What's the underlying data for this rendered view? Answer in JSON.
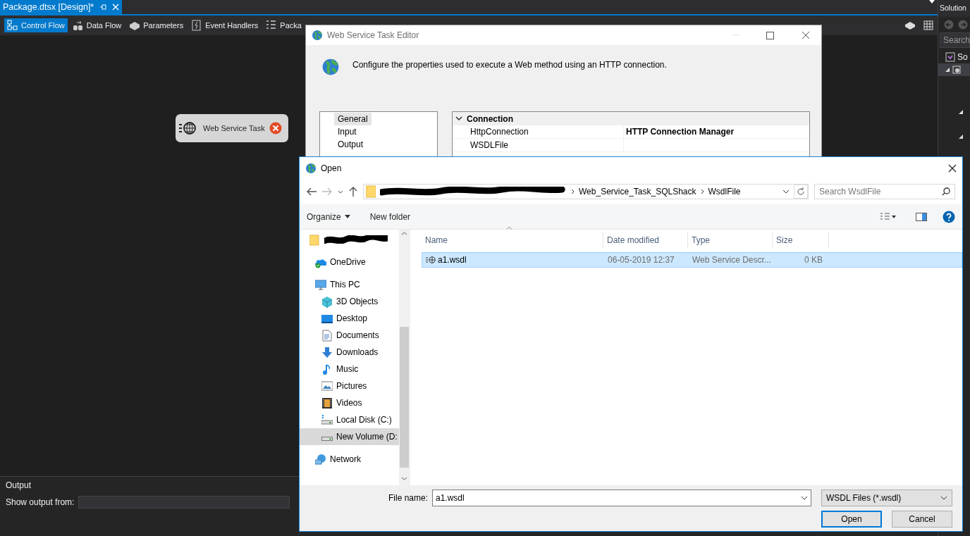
{
  "ide": {
    "document_tab": {
      "title": "Package.dtsx [Design]*"
    },
    "designer_tabs": [
      {
        "label": "Control Flow",
        "kind": "control_flow",
        "selected": true
      },
      {
        "label": "Data Flow",
        "kind": "data_flow",
        "selected": false
      },
      {
        "label": "Parameters",
        "kind": "parameters",
        "selected": false
      },
      {
        "label": "Event Handlers",
        "kind": "event_handlers",
        "selected": false
      },
      {
        "label": "Packa",
        "kind": "package_explorer",
        "selected": false
      }
    ],
    "canvas": {
      "tasks": [
        {
          "label": "Web Service Task",
          "error": true
        }
      ]
    },
    "output": {
      "title": "Output",
      "source_label": "Show output from:"
    },
    "solution_explorer": {
      "title": "Solution",
      "search_placeholder": "Search",
      "items": [
        {
          "label": "So",
          "kind": "solution",
          "selected": false
        },
        {
          "kind": "project",
          "selected": true,
          "expanded": true,
          "children": [
            {
              "expanded": true
            },
            {
              "expanded": true
            }
          ]
        }
      ]
    }
  },
  "editor": {
    "title": "Web Service Task Editor",
    "description": "Configure the properties used to execute a Web method using an HTTP connection.",
    "pages": [
      {
        "label": "General",
        "selected": true
      },
      {
        "label": "Input",
        "selected": false
      },
      {
        "label": "Output",
        "selected": false
      }
    ],
    "properties": {
      "category": "Connection",
      "expanded": true,
      "rows": [
        {
          "name": "HttpConnection",
          "value": "HTTP Connection Manager",
          "modified": true
        },
        {
          "name": "WSDLFile"
        }
      ]
    }
  },
  "open_dialog": {
    "title": "Open",
    "path_redacted": true,
    "path": [
      "Web_Service_Task_SQLShack",
      "WsdlFile"
    ],
    "search_placeholder": "Search WsdlFile",
    "organize": "Organize",
    "new_folder": "New folder",
    "nav": [
      {
        "kind": "folder",
        "redacted": true,
        "selected": false
      },
      {
        "label": "OneDrive",
        "kind": "onedrive",
        "selected": false
      },
      {
        "label": "This PC",
        "kind": "pc",
        "selected": false,
        "children": [
          {
            "label": "3D Objects",
            "kind": "objects3d",
            "selected": false
          },
          {
            "label": "Desktop",
            "kind": "desktop",
            "selected": false
          },
          {
            "label": "Documents",
            "kind": "documents",
            "selected": false
          },
          {
            "label": "Downloads",
            "kind": "downloads",
            "selected": false
          },
          {
            "label": "Music",
            "kind": "music",
            "selected": false
          },
          {
            "label": "Pictures",
            "kind": "pictures",
            "selected": false
          },
          {
            "label": "Videos",
            "kind": "videos",
            "selected": false
          },
          {
            "label": "Local Disk (C:)",
            "kind": "disk",
            "selected": false
          },
          {
            "label": "New Volume (D:",
            "kind": "drive",
            "selected": true
          }
        ]
      },
      {
        "label": "Network",
        "kind": "network",
        "selected": false
      }
    ],
    "columns": [
      {
        "label": "Name",
        "sorted": true
      },
      {
        "label": "Date modified",
        "sorted": false
      },
      {
        "label": "Type",
        "sorted": false
      },
      {
        "label": "Size",
        "sorted": false
      }
    ],
    "files": [
      {
        "name": "a1.wsdl",
        "date": "06-05-2019 12:37",
        "type": "Web Service Descr...",
        "size": "0 KB",
        "selected": true
      }
    ],
    "file_name_label": "File name:",
    "file_name": "a1.wsdl",
    "file_type": "WSDL Files (*.wsdl)",
    "buttons": [
      {
        "label": "Open",
        "default": true
      },
      {
        "label": "Cancel",
        "default": false
      }
    ]
  }
}
